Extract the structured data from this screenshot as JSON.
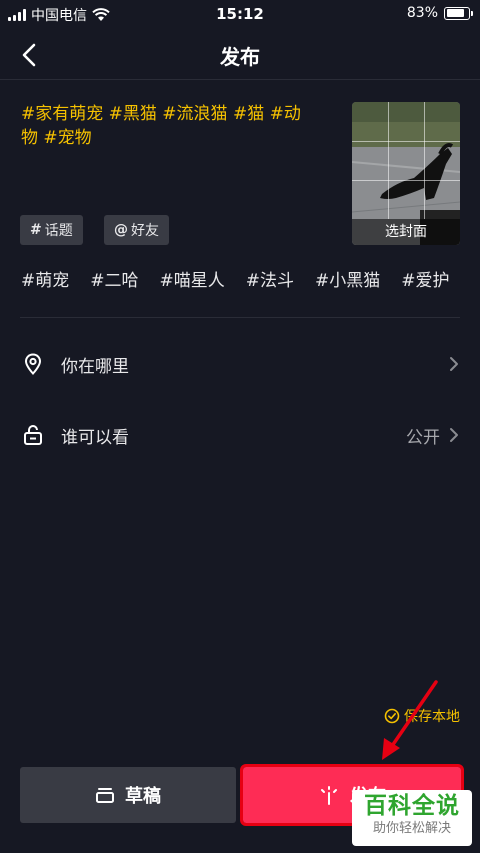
{
  "status_bar": {
    "carrier": "中国电信",
    "time": "15:12",
    "battery_percent": "83%",
    "battery_level": 0.83,
    "icons": [
      "signal-icon",
      "wifi-icon",
      "battery-icon"
    ]
  },
  "nav": {
    "title": "发布",
    "back_icon": "chevron-left-icon"
  },
  "caption": {
    "line1": "#家有萌宠 #黑猫 #流浪猫 #猫 #动",
    "line2": "物 #宠物"
  },
  "cover": {
    "label": "选封面"
  },
  "chips": {
    "topic": "话题",
    "topic_icon": "#",
    "friends": "好友",
    "friends_icon": "@"
  },
  "suggested_tags": [
    "#萌宠",
    "#二哈",
    "#喵星人",
    "#法斗",
    "#小黑猫",
    "#爱护"
  ],
  "location_row": {
    "label": "你在哪里",
    "icon": "location-pin-icon"
  },
  "visibility_row": {
    "label": "谁可以看",
    "value": "公开",
    "icon": "unlock-icon"
  },
  "save_local": {
    "label": "保存本地",
    "checked": true
  },
  "buttons": {
    "draft": "草稿",
    "publish": "发布"
  },
  "watermark": {
    "big": "百科全说",
    "small": "助你轻松解决"
  },
  "colors": {
    "background": "#161823",
    "accent_yellow": "#f5c100",
    "publish_red": "#fe2c55",
    "chip_gray": "#393b44",
    "annotation_red": "#e60012",
    "watermark_green": "#2fa52f"
  }
}
